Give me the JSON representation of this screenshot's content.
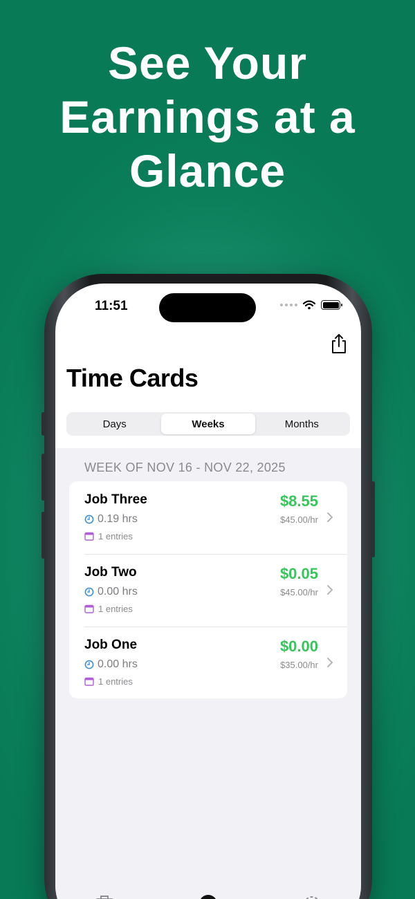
{
  "headline": [
    "See Your",
    "Earnings at a",
    "Glance"
  ],
  "status_bar": {
    "time": "11:51"
  },
  "screen": {
    "title": "Time Cards",
    "segments": [
      {
        "label": "Days",
        "selected": false
      },
      {
        "label": "Weeks",
        "selected": true
      },
      {
        "label": "Months",
        "selected": false
      }
    ],
    "section_header": "WEEK OF NOV 16 - NOV 22, 2025",
    "jobs": [
      {
        "name": "Job Three",
        "hours": "0.19 hrs",
        "entries": "1 entries",
        "amount": "$8.55",
        "rate": "$45.00/hr"
      },
      {
        "name": "Job Two",
        "hours": "0.00 hrs",
        "entries": "1 entries",
        "amount": "$0.05",
        "rate": "$45.00/hr"
      },
      {
        "name": "Job One",
        "hours": "0.00 hrs",
        "entries": "1 entries",
        "amount": "$0.00",
        "rate": "$35.00/hr"
      }
    ]
  },
  "colors": {
    "background": "#0b7e5a",
    "amount_green": "#34c759",
    "clock_icon": "#3b8fd9",
    "calendar_icon": "#b05ed6"
  },
  "icons": [
    "share-icon",
    "clock-icon",
    "calendar-icon",
    "chevron-right-icon",
    "wifi-icon",
    "battery-icon"
  ]
}
